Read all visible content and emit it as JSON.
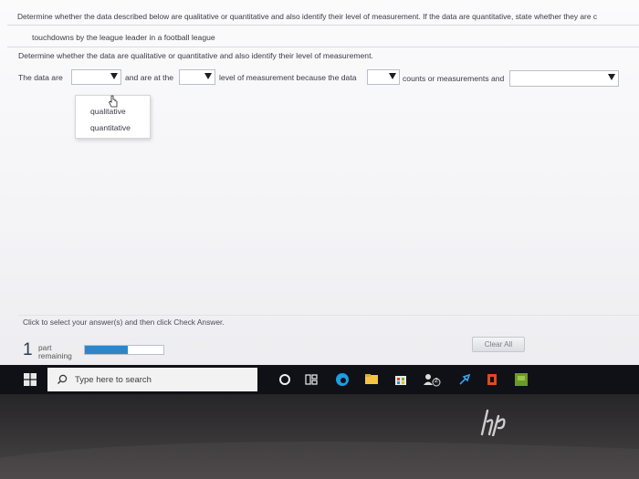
{
  "question": {
    "instruction": "Determine whether the data described below are qualitative or quantitative and also identify their level of measurement. If the data are quantitative, state whether they are c",
    "data_description": "touchdowns by the league leader in a football league",
    "sub_instruction": "Determine whether the data are qualitative or quantitative and also identify their level of measurement."
  },
  "answer_sentence": {
    "part1": "The data are",
    "part2": "and are at the",
    "part3": "level of measurement because the data",
    "part4": "counts or measurements and"
  },
  "dropdown_menu": {
    "options": [
      "qualitative",
      "quantitative"
    ]
  },
  "footer": {
    "hint": "Click to select your answer(s) and then click Check Answer.",
    "clear_all": "Clear All",
    "parts_count": "1",
    "parts_label_1": "part",
    "parts_label_2": "remaining",
    "progress_fraction": 0.55
  },
  "taskbar": {
    "search_placeholder": "Type here to search",
    "badge_count": "2"
  },
  "colors": {
    "accent": "#2e86c9",
    "taskbar": "#0f1117"
  },
  "icons": [
    "windows-icon",
    "search-icon",
    "cortana-icon",
    "task-view-icon",
    "edge-icon",
    "file-explorer-icon",
    "store-icon",
    "people-icon",
    "pen-icon",
    "office-icon",
    "game-icon",
    "hp-logo"
  ]
}
